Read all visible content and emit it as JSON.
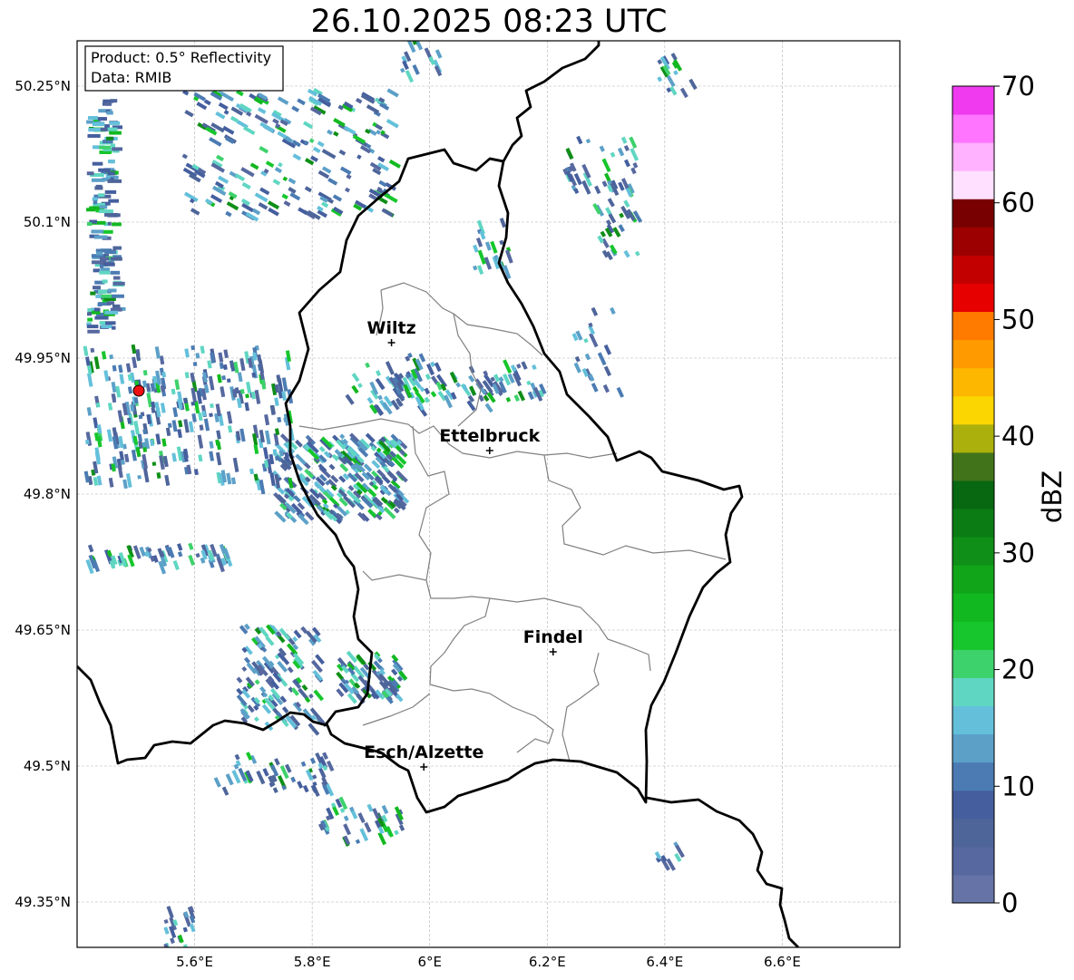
{
  "title": "26.10.2025 08:23 UTC",
  "info": {
    "product_line": "Product: 0.5° Reflectivity",
    "data_line": "Data: RMIB"
  },
  "axes": {
    "lon_ticks": [
      {
        "value": 5.6,
        "label": "5.6°E"
      },
      {
        "value": 5.8,
        "label": "5.8°E"
      },
      {
        "value": 6.0,
        "label": "6°E"
      },
      {
        "value": 6.2,
        "label": "6.2°E"
      },
      {
        "value": 6.4,
        "label": "6.4°E"
      },
      {
        "value": 6.6,
        "label": "6.6°E"
      }
    ],
    "lat_ticks": [
      {
        "value": 50.25,
        "label": "50.25°N"
      },
      {
        "value": 50.1,
        "label": "50.1°N"
      },
      {
        "value": 49.95,
        "label": "49.95°N"
      },
      {
        "value": 49.8,
        "label": "49.8°N"
      },
      {
        "value": 49.65,
        "label": "49.65°N"
      },
      {
        "value": 49.5,
        "label": "49.5°N"
      },
      {
        "value": 49.35,
        "label": "49.35°N"
      }
    ],
    "lon_range": [
      5.4,
      6.8
    ],
    "lat_range": [
      49.3,
      50.3
    ]
  },
  "cities": [
    {
      "name": "Wiltz",
      "lon": 5.935,
      "lat": 49.967
    },
    {
      "name": "Ettelbruck",
      "lon": 6.102,
      "lat": 49.848
    },
    {
      "name": "Findel",
      "lon": 6.21,
      "lat": 49.626
    },
    {
      "name": "Esch/Alzette",
      "lon": 5.99,
      "lat": 49.499
    }
  ],
  "radar_site": {
    "lon": 5.505,
    "lat": 49.914,
    "color": "#ee1111"
  },
  "colorbar": {
    "label": "dBZ",
    "min": 0,
    "max": 70,
    "tick_labels": [
      "0",
      "10",
      "20",
      "30",
      "40",
      "50",
      "60",
      "70"
    ],
    "tick_values": [
      0,
      10,
      20,
      30,
      40,
      50,
      60,
      70
    ],
    "colors": [
      "#6573a6",
      "#56689f",
      "#4e659a",
      "#455f9e",
      "#4b7bb2",
      "#5ca0c8",
      "#64c0da",
      "#5fd6c2",
      "#3dd26b",
      "#16c62c",
      "#12b81f",
      "#11a519",
      "#0f8f17",
      "#0b7c14",
      "#086711",
      "#41741a",
      "#abb00c",
      "#fcd600",
      "#fdb700",
      "#ff9a00",
      "#ff7b00",
      "#e60000",
      "#c20000",
      "#9c0000",
      "#780000",
      "#ffe1ff",
      "#ffb2ff",
      "#ff75ff",
      "#ef3af0"
    ]
  },
  "colors": {
    "border": "#000000",
    "cantons": "#808080",
    "grid": "#b0b0b0"
  }
}
